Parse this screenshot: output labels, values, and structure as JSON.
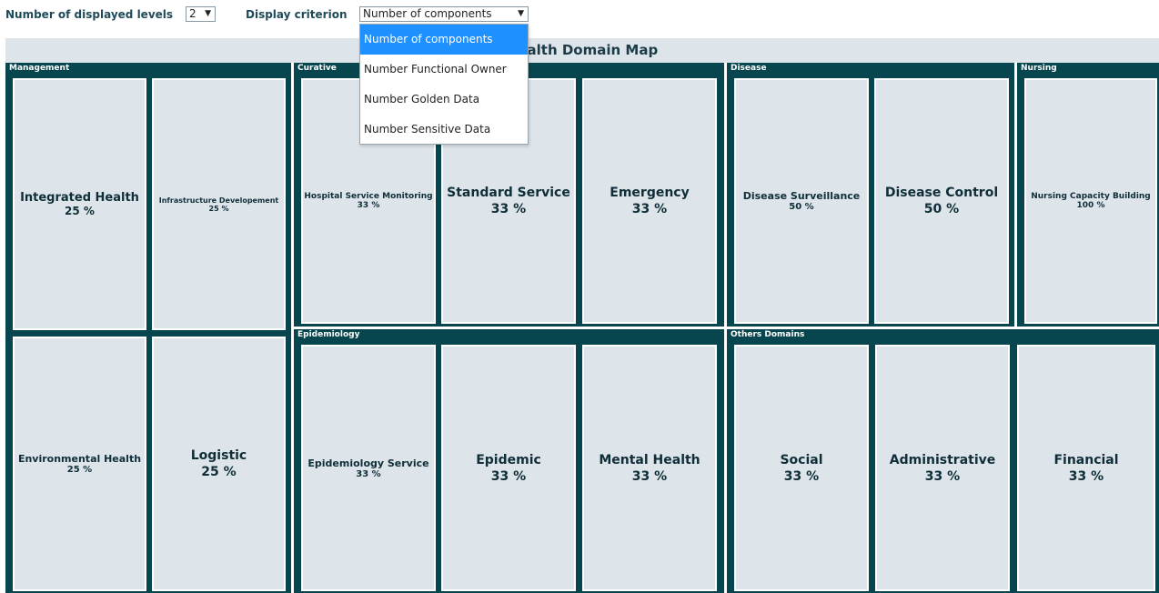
{
  "controls": {
    "levels_label": "Number of displayed levels",
    "levels_value": "2",
    "criterion_label": "Display criterion",
    "criterion_value": "Number of components"
  },
  "map": {
    "title": "Health Domain Map"
  },
  "dropdown": {
    "options": [
      "Number of components",
      "Number Functional Owner",
      "Number Golden Data",
      "Number Sensitive Data"
    ],
    "selected_index": 0
  },
  "domains": {
    "management": {
      "label": "Management",
      "tiles": [
        {
          "name": "Integrated Health",
          "pct": "25 %"
        },
        {
          "name": "Infrastructure Developement",
          "pct": "25 %"
        },
        {
          "name": "Environmental Health",
          "pct": "25 %"
        },
        {
          "name": "Logistic",
          "pct": "25 %"
        }
      ]
    },
    "curative": {
      "label": "Curative",
      "tiles": [
        {
          "name": "Hospital Service Monitoring",
          "pct": "33 %"
        },
        {
          "name": "Standard Service",
          "pct": "33 %"
        },
        {
          "name": "Emergency",
          "pct": "33 %"
        }
      ]
    },
    "disease": {
      "label": "Disease",
      "tiles": [
        {
          "name": "Disease Surveillance",
          "pct": "50 %"
        },
        {
          "name": "Disease Control",
          "pct": "50 %"
        }
      ]
    },
    "nursing": {
      "label": "Nursing",
      "tiles": [
        {
          "name": "Nursing Capacity Building",
          "pct": "100 %"
        }
      ]
    },
    "epidemiology": {
      "label": "Epidemiology",
      "tiles": [
        {
          "name": "Epidemiology Service",
          "pct": "33 %"
        },
        {
          "name": "Epidemic",
          "pct": "33 %"
        },
        {
          "name": "Mental Health",
          "pct": "33 %"
        }
      ]
    },
    "others": {
      "label": "Others Domains",
      "tiles": [
        {
          "name": "Social",
          "pct": "33 %"
        },
        {
          "name": "Administrative",
          "pct": "33 %"
        },
        {
          "name": "Financial",
          "pct": "33 %"
        }
      ]
    }
  },
  "colors": {
    "domain_bg": "#08464f",
    "tile_bg": "#dde4ea",
    "dropdown_active": "#1e90ff"
  }
}
